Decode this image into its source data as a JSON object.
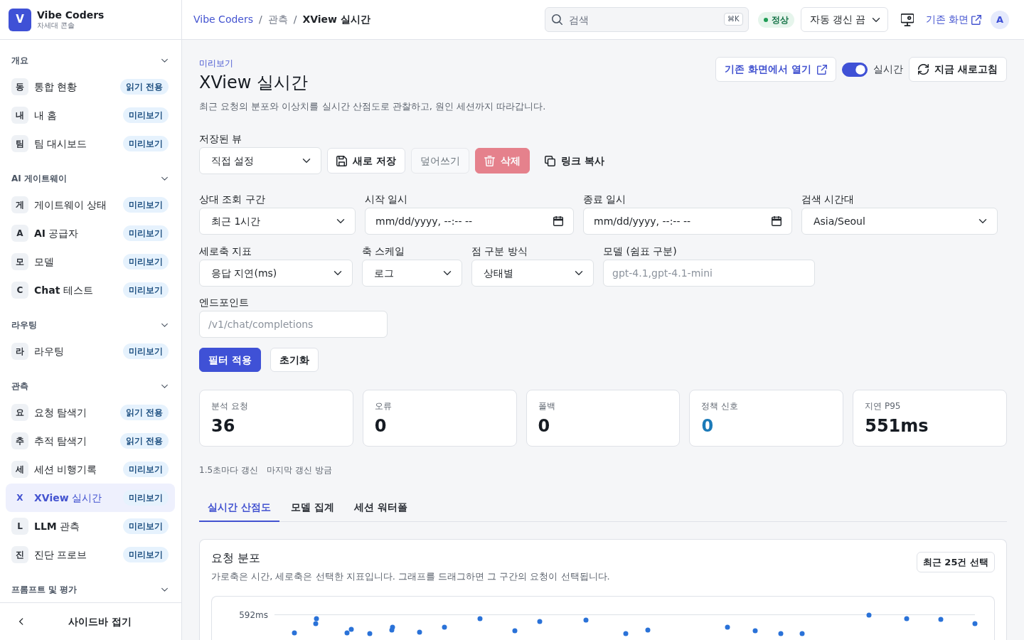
{
  "sidebar": {
    "brand": {
      "logo": "V",
      "name": "Vibe Coders",
      "subtitle": "차세대 콘솔"
    },
    "sections": [
      {
        "title": "개요",
        "items": [
          {
            "initial": "동",
            "label": "통합 현황",
            "badge": "읽기 전용",
            "selected": false
          },
          {
            "initial": "내",
            "label": "내 홈",
            "badge": "미리보기",
            "selected": false
          },
          {
            "initial": "팀",
            "label": "팀 대시보드",
            "badge": "미리보기",
            "selected": false
          }
        ]
      },
      {
        "title": "AI 게이트웨이",
        "items": [
          {
            "initial": "게",
            "label": "게이트웨이 상태",
            "badge": "미리보기",
            "selected": false
          },
          {
            "initial": "A",
            "label": "**AI** 공급자",
            "badge": "미리보기",
            "selected": false
          },
          {
            "initial": "모",
            "label": "모델",
            "badge": "미리보기",
            "selected": false
          },
          {
            "initial": "C",
            "label": "**Chat** 테스트",
            "badge": "미리보기",
            "selected": false
          }
        ]
      },
      {
        "title": "라우팅",
        "items": [
          {
            "initial": "라",
            "label": "라우팅",
            "badge": "미리보기",
            "selected": false
          }
        ]
      },
      {
        "title": "관측",
        "items": [
          {
            "initial": "요",
            "label": "요청 탐색기",
            "badge": "읽기 전용",
            "selected": false
          },
          {
            "initial": "추",
            "label": "추적 탐색기",
            "badge": "읽기 전용",
            "selected": false
          },
          {
            "initial": "세",
            "label": "세션 비행기록",
            "badge": "미리보기",
            "selected": false
          },
          {
            "initial": "X",
            "label": "**XView** 실시간",
            "badge": "미리보기",
            "selected": true
          },
          {
            "initial": "L",
            "label": "**LLM** 관측",
            "badge": "미리보기",
            "selected": false
          },
          {
            "initial": "진",
            "label": "진단 프로브",
            "badge": "미리보기",
            "selected": false
          }
        ]
      },
      {
        "title": "프롬프트 및 평가"
      }
    ],
    "collapse": {
      "label": "사이드바 접기"
    }
  },
  "topbar": {
    "breadcrumb": [
      {
        "kind": "link",
        "label": "Vibe Coders"
      },
      {
        "kind": "separator",
        "label": "/"
      },
      {
        "kind": "item",
        "label": "관측"
      },
      {
        "kind": "separator",
        "label": "/"
      },
      {
        "kind": "current",
        "label": "XView 실시간"
      }
    ],
    "search": {
      "placeholder": "검색",
      "shortcut": "⌘K"
    },
    "status": {
      "label": "정상"
    },
    "auto_refresh": {
      "value": "자동 갱신 끔"
    },
    "legacy_link": {
      "label": "기존 화면"
    },
    "avatar": {
      "initial": "A"
    }
  },
  "header": {
    "eyebrow": "미리보기",
    "title": "XView 실시간",
    "description": "최근 요청의 분포와 이상치를 실시간 산점도로 관찰하고, 원인 세션까지 따라갑니다.",
    "open_legacy_button": "기존 화면에서 열기",
    "live_toggle": {
      "label": "실시간",
      "on": true
    },
    "refresh_button": "지금 새로고침"
  },
  "saved_views": {
    "label": "저장된 뷰",
    "value": "직접 설정",
    "buttons": [
      {
        "kind": "save",
        "label": "새로 저장",
        "disabled": false
      },
      {
        "kind": "overwrite",
        "label": "덮어쓰기",
        "disabled": true
      },
      {
        "kind": "delete",
        "label": "삭제",
        "disabled": true
      },
      {
        "kind": "copy",
        "label": "링크 복사",
        "disabled": false
      }
    ]
  },
  "filters": {
    "fields": [
      {
        "kind": "select",
        "label": "상대 조회 구간",
        "value": "최근 1시간"
      },
      {
        "kind": "datetime",
        "label": "시작 일시",
        "value": "mm/dd/yyyy, --:-- --"
      },
      {
        "kind": "datetime",
        "label": "종료 일시",
        "value": "mm/dd/yyyy, --:-- --"
      },
      {
        "kind": "select",
        "label": "검색 시간대",
        "value": "Asia/Seoul"
      },
      {
        "kind": "select",
        "label": "세로축 지표",
        "value": "응답 지연(ms)"
      },
      {
        "kind": "select",
        "label": "축 스케일",
        "value": "로그"
      },
      {
        "kind": "select",
        "label": "점 구분 방식",
        "value": "상태별"
      },
      {
        "kind": "text",
        "label": "모델 (쉼표 구분)",
        "placeholder": "gpt-4.1,gpt-4.1-mini"
      },
      {
        "kind": "text",
        "label": "엔드포인트",
        "placeholder": "/v1/chat/completions"
      }
    ],
    "actions": [
      {
        "kind": "primary",
        "label": "필터 적용"
      },
      {
        "kind": "secondary",
        "label": "초기화"
      }
    ]
  },
  "stats": [
    {
      "label": "분석 요청",
      "value": "36",
      "color": "#161b22"
    },
    {
      "label": "오류",
      "value": "0",
      "color": "#161b22"
    },
    {
      "label": "폴백",
      "value": "0",
      "color": "#161b22"
    },
    {
      "label": "정책 신호",
      "value": "0",
      "color": "#1b7ab8"
    },
    {
      "label": "지연 P95",
      "value": "551ms",
      "color": "#161b22"
    }
  ],
  "refresh_info": [
    "1.5초마다 갱신",
    "마지막 갱신 방금"
  ],
  "tabs": [
    {
      "label": "실시간 산점도",
      "selected": true
    },
    {
      "label": "모델 집계",
      "selected": false
    },
    {
      "label": "세션 워터폴",
      "selected": false
    }
  ],
  "chart_panel": {
    "title": "요청 분포",
    "description": "가로축은 시간, 세로축은 선택한 지표입니다. 그래프를 드래그하면 그 구간의 요청이 선택됩니다.",
    "button": "최근 25건 선택",
    "y_tick": "592ms"
  }
}
